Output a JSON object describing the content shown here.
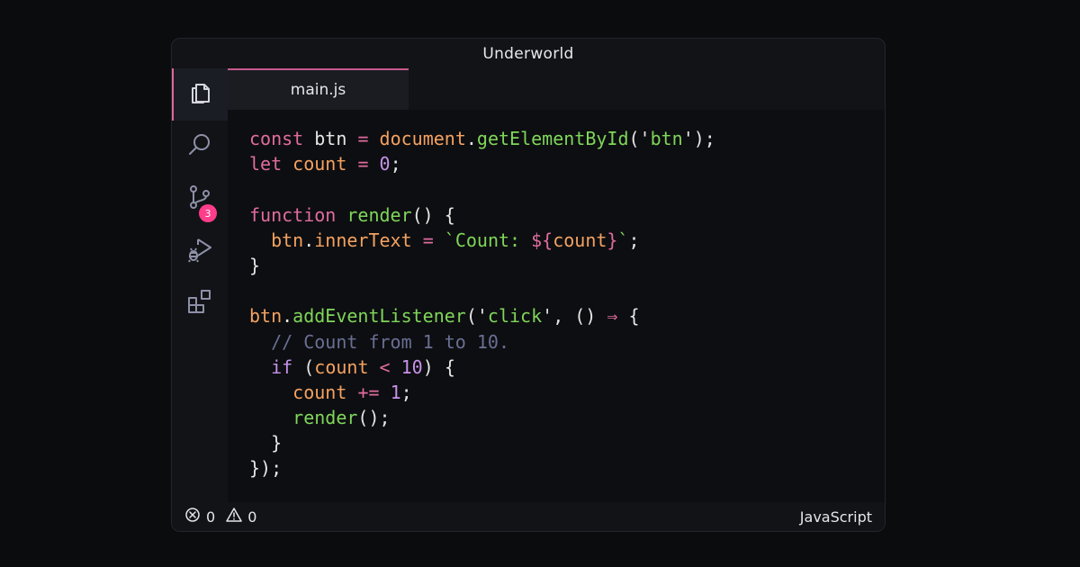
{
  "window": {
    "title": "Underworld"
  },
  "activity_bar": {
    "items": [
      {
        "name": "explorer",
        "icon": "files-icon",
        "active": true
      },
      {
        "name": "search",
        "icon": "search-icon"
      },
      {
        "name": "source-control",
        "icon": "source-control-icon",
        "badge": "3"
      },
      {
        "name": "run-debug",
        "icon": "run-debug-icon"
      },
      {
        "name": "extensions",
        "icon": "extensions-icon"
      }
    ]
  },
  "tabs": [
    {
      "label": "main.js",
      "active": true
    }
  ],
  "editor": {
    "lines": [
      [
        {
          "t": "const",
          "c": "kw"
        },
        {
          "t": " "
        },
        {
          "t": "btn",
          "c": "pn"
        },
        {
          "t": " "
        },
        {
          "t": "=",
          "c": "op"
        },
        {
          "t": " "
        },
        {
          "t": "document",
          "c": "var"
        },
        {
          "t": ".",
          "c": "pn"
        },
        {
          "t": "getElementById",
          "c": "fn"
        },
        {
          "t": "(",
          "c": "pn"
        },
        {
          "t": "'",
          "c": "pn"
        },
        {
          "t": "btn",
          "c": "str"
        },
        {
          "t": "'",
          "c": "pn"
        },
        {
          "t": ");",
          "c": "pn"
        }
      ],
      [
        {
          "t": "let",
          "c": "kw"
        },
        {
          "t": " "
        },
        {
          "t": "count",
          "c": "var"
        },
        {
          "t": " "
        },
        {
          "t": "=",
          "c": "op"
        },
        {
          "t": " "
        },
        {
          "t": "0",
          "c": "num"
        },
        {
          "t": ";",
          "c": "pn"
        }
      ],
      [],
      [
        {
          "t": "function",
          "c": "kw"
        },
        {
          "t": " "
        },
        {
          "t": "render",
          "c": "fn"
        },
        {
          "t": "() {",
          "c": "pn"
        }
      ],
      [
        {
          "t": "  "
        },
        {
          "t": "btn",
          "c": "var"
        },
        {
          "t": ".",
          "c": "pn"
        },
        {
          "t": "innerText",
          "c": "var"
        },
        {
          "t": " "
        },
        {
          "t": "=",
          "c": "op"
        },
        {
          "t": " "
        },
        {
          "t": "`Count: ",
          "c": "str"
        },
        {
          "t": "${",
          "c": "tpl"
        },
        {
          "t": "count",
          "c": "var"
        },
        {
          "t": "}",
          "c": "tpl"
        },
        {
          "t": "`",
          "c": "str"
        },
        {
          "t": ";",
          "c": "pn"
        }
      ],
      [
        {
          "t": "}",
          "c": "pn"
        }
      ],
      [],
      [
        {
          "t": "btn",
          "c": "var"
        },
        {
          "t": ".",
          "c": "pn"
        },
        {
          "t": "addEventListener",
          "c": "fn"
        },
        {
          "t": "(",
          "c": "pn"
        },
        {
          "t": "'",
          "c": "pn"
        },
        {
          "t": "click",
          "c": "str"
        },
        {
          "t": "'",
          "c": "pn"
        },
        {
          "t": ", () ",
          "c": "pn"
        },
        {
          "t": "⇒",
          "c": "op"
        },
        {
          "t": " {",
          "c": "pn"
        }
      ],
      [
        {
          "t": "  "
        },
        {
          "t": "// Count from 1 to 10.",
          "c": "cm"
        }
      ],
      [
        {
          "t": "  "
        },
        {
          "t": "if",
          "c": "ctl"
        },
        {
          "t": " (",
          "c": "pn"
        },
        {
          "t": "count",
          "c": "var"
        },
        {
          "t": " "
        },
        {
          "t": "<",
          "c": "op"
        },
        {
          "t": " "
        },
        {
          "t": "10",
          "c": "num"
        },
        {
          "t": ") {",
          "c": "pn"
        }
      ],
      [
        {
          "t": "    "
        },
        {
          "t": "count",
          "c": "var"
        },
        {
          "t": " "
        },
        {
          "t": "+=",
          "c": "op"
        },
        {
          "t": " "
        },
        {
          "t": "1",
          "c": "num"
        },
        {
          "t": ";",
          "c": "pn"
        }
      ],
      [
        {
          "t": "    "
        },
        {
          "t": "render",
          "c": "fn"
        },
        {
          "t": "();",
          "c": "pn"
        }
      ],
      [
        {
          "t": "  }",
          "c": "pn"
        }
      ],
      [
        {
          "t": "});",
          "c": "pn"
        }
      ]
    ]
  },
  "status_bar": {
    "errors": "0",
    "warnings": "0",
    "language": "JavaScript"
  },
  "colors": {
    "keyword": "#e06c9f",
    "variable": "#f4a261",
    "function": "#7fd65a",
    "number": "#c792ea",
    "comment": "#6a6f94",
    "badge": "#ff3d8b"
  }
}
